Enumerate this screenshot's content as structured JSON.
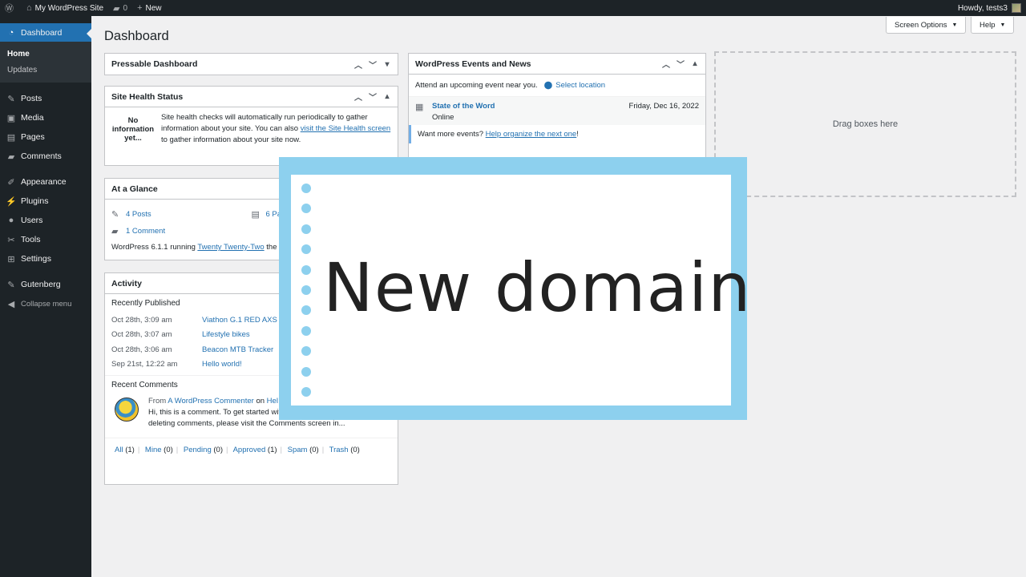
{
  "adminbar": {
    "site_name": "My WordPress Site",
    "comments_count": "0",
    "new_label": "New",
    "greeting": "Howdy, tests3"
  },
  "sidebar": {
    "items": [
      {
        "label": "Dashboard",
        "icon": "dashboard-icon"
      },
      {
        "label": "Posts",
        "icon": "pin-icon"
      },
      {
        "label": "Media",
        "icon": "media-icon"
      },
      {
        "label": "Pages",
        "icon": "pages-icon"
      },
      {
        "label": "Comments",
        "icon": "comment-icon"
      },
      {
        "label": "Appearance",
        "icon": "brush-icon"
      },
      {
        "label": "Plugins",
        "icon": "plugin-icon"
      },
      {
        "label": "Users",
        "icon": "user-icon"
      },
      {
        "label": "Tools",
        "icon": "wrench-icon"
      },
      {
        "label": "Settings",
        "icon": "settings-icon"
      },
      {
        "label": "Gutenberg",
        "icon": "gutenberg-icon"
      },
      {
        "label": "Collapse menu",
        "icon": "collapse-icon"
      }
    ],
    "submenu": [
      "Home",
      "Updates"
    ]
  },
  "header": {
    "title": "Dashboard",
    "screen_options": "Screen Options",
    "help": "Help"
  },
  "pressable": {
    "title": "Pressable Dashboard"
  },
  "health": {
    "title": "Site Health Status",
    "no_info": "No information yet...",
    "text_1": "Site health checks will automatically run periodically to gather information about your site. You can also ",
    "link": "visit the Site Health screen",
    "text_2": " to gather information about your site now."
  },
  "glance": {
    "title": "At a Glance",
    "posts": "4 Posts",
    "pages": "6 Pa",
    "comments": "1 Comment",
    "footer_1": "WordPress 6.1.1 running ",
    "theme_link": "Twenty Twenty-Two",
    "footer_2": " the"
  },
  "activity": {
    "title": "Activity",
    "recently_published": "Recently Published",
    "posts": [
      {
        "date": "Oct 28th, 3:09 am",
        "title": "Viathon G.1 RED AXS"
      },
      {
        "date": "Oct 28th, 3:07 am",
        "title": "Lifestyle bikes"
      },
      {
        "date": "Oct 28th, 3:06 am",
        "title": "Beacon MTB Tracker"
      },
      {
        "date": "Sep 21st, 12:22 am",
        "title": "Hello world!"
      }
    ],
    "recent_comments": "Recent Comments",
    "comment_from": "From ",
    "comment_author": "A WordPress Commenter",
    "comment_on": " on ",
    "comment_post": "Hel",
    "comment_text": "Hi, this is a comment. To get started with moderating, editing, and deleting comments, please visit the Comments screen in...",
    "filters": [
      {
        "label": "All",
        "count": " (1)"
      },
      {
        "label": "Mine",
        "count": " (0)"
      },
      {
        "label": "Pending",
        "count": " (0)"
      },
      {
        "label": "Approved",
        "count": " (1)"
      },
      {
        "label": "Spam",
        "count": " (0)"
      },
      {
        "label": "Trash",
        "count": " (0)"
      }
    ]
  },
  "events": {
    "title": "WordPress Events and News",
    "attend": "Attend an upcoming event near you.",
    "select_location": "Select location",
    "event_title": "State of the Word",
    "event_sub": "Online",
    "event_date": "Friday, Dec 16, 2022",
    "more_1": "Want more events? ",
    "more_link": "Help organize the next one",
    "more_2": "!"
  },
  "dropzone": {
    "label": "Drag boxes here"
  },
  "overlay": {
    "text": "New domain"
  },
  "colors": {
    "accent": "#2271b1",
    "overlay": "#8dd0ee",
    "adminbar": "#1d2327"
  }
}
